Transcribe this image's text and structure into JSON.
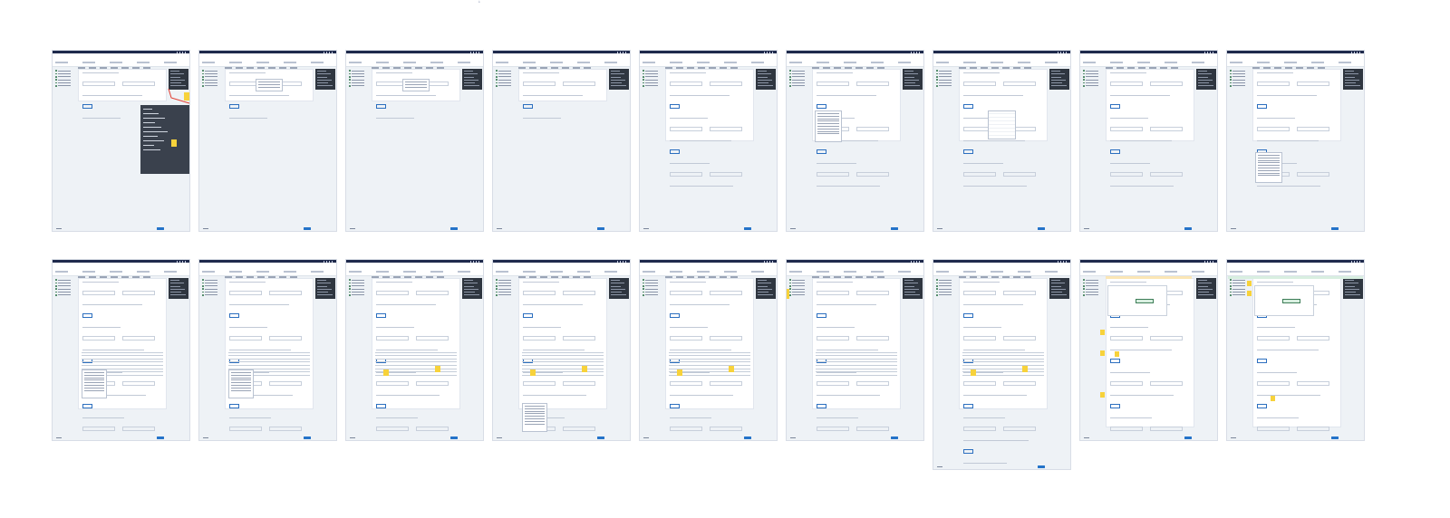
{
  "canvas": {
    "top_label": "ŝ",
    "background": "#ffffff"
  },
  "frame_common": {
    "topbar_color": "#1f2a4c",
    "accent": "#2473c9",
    "panel_color": "#2f3640",
    "note_color": "#f7d23b",
    "annotation_arrow_color": "#e23b2e"
  },
  "frames": [
    {
      "id": "f1",
      "variant": "tooltip-overlay"
    },
    {
      "id": "f2",
      "variant": "dropdown-small"
    },
    {
      "id": "f3",
      "variant": "dropdown-small"
    },
    {
      "id": "f4",
      "variant": "base"
    },
    {
      "id": "f5",
      "variant": "extra-section"
    },
    {
      "id": "f6",
      "variant": "dropdown-list"
    },
    {
      "id": "f7",
      "variant": "date-picker"
    },
    {
      "id": "f8",
      "variant": "extra-section"
    },
    {
      "id": "f9",
      "variant": "extra-section-list"
    },
    {
      "id": "f10",
      "variant": "table-dropdown"
    },
    {
      "id": "f11",
      "variant": "table-dropdown"
    },
    {
      "id": "f12",
      "variant": "table-notes"
    },
    {
      "id": "f13",
      "variant": "table-dropdown-list"
    },
    {
      "id": "f14",
      "variant": "table-notes"
    },
    {
      "id": "f15",
      "variant": "table-notes-left"
    },
    {
      "id": "f16",
      "variant": "table-long"
    },
    {
      "id": "f17",
      "variant": "review-notes"
    },
    {
      "id": "f18",
      "variant": "review-success"
    }
  ]
}
